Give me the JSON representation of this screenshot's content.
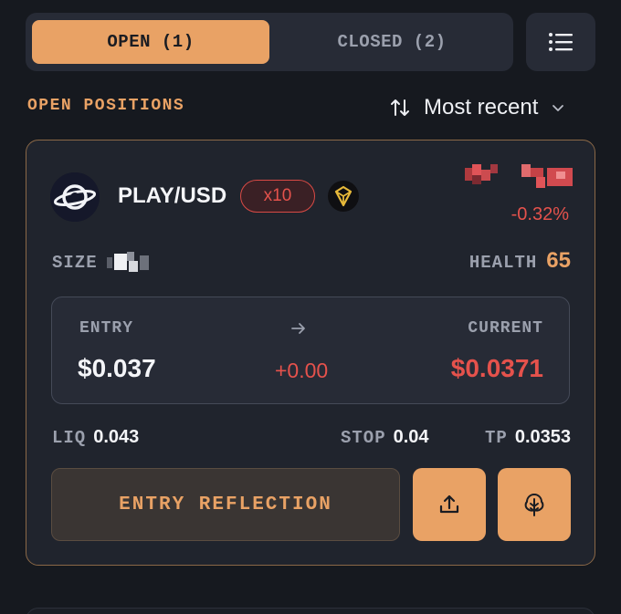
{
  "tabs": {
    "open_label": "OPEN (1)",
    "closed_label": "CLOSED (2)"
  },
  "menu": {
    "icon": "list-icon"
  },
  "section": {
    "title": "OPEN POSITIONS",
    "sort_label": "Most recent",
    "sort_icon": "sort-arrows-icon",
    "sort_chevron": "chevron-down-icon"
  },
  "position": {
    "pair": "PLAY/USD",
    "leverage": "x10",
    "pnl_percent": "-0.32%",
    "size_label": "SIZE",
    "health_label": "HEALTH",
    "health_value": "65",
    "entry_label": "ENTRY",
    "current_label": "CURRENT",
    "entry_value": "$0.037",
    "change_value": "+0.00",
    "current_value": "$0.0371",
    "liq_label": "LIQ",
    "liq_value": "0.043",
    "stop_label": "STOP",
    "stop_value": "0.04",
    "tp_label": "TP",
    "tp_value": "0.0353",
    "reflection_label": "ENTRY REFLECTION",
    "share_icon": "share-upload-icon",
    "tree_icon": "tree-icon"
  },
  "colors": {
    "accent": "#e9a265",
    "negative": "#e5524c",
    "background": "#16191f",
    "card": "#20242d"
  }
}
